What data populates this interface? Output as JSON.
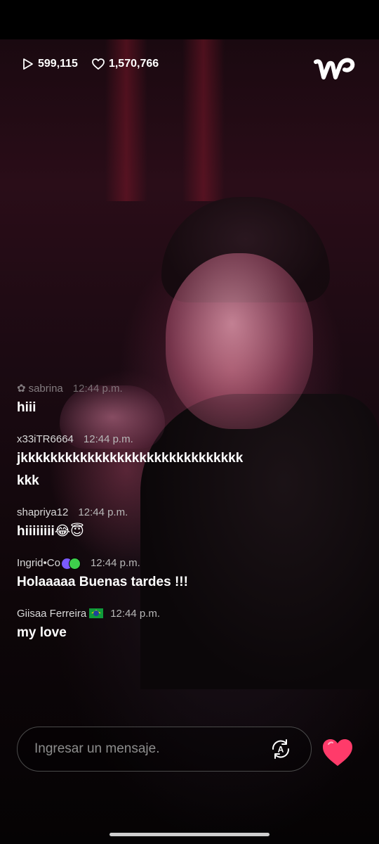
{
  "stats": {
    "plays_icon": "play-icon",
    "plays": "599,115",
    "likes_icon": "heart-outline-icon",
    "likes": "1,570,766"
  },
  "logo": {
    "icon": "weverse-logo"
  },
  "chat": {
    "messages": [
      {
        "user": "sabrina",
        "time": "12:44 p.m.",
        "text": "hiii"
      },
      {
        "user": "x33iTR6664",
        "time": "12:44 p.m.",
        "text": "jkkkkkkkkkkkkkkkkkkkkkkkkkkkkkkkkk"
      },
      {
        "user": "shapriya12",
        "time": "12:44 p.m.",
        "text": "hiiiiiiii😂😇"
      },
      {
        "user": "Ingrid•Co",
        "time": "12:44 p.m.",
        "text": "Holaaaaa Buenas tardes !!!"
      },
      {
        "user": "Giisaa Ferreira",
        "time": "12:44 p.m.",
        "text": "my love"
      }
    ]
  },
  "input": {
    "placeholder": "Ingresar un mensaje.",
    "translate_icon": "translate-icon"
  },
  "heart_button": {
    "icon": "heart-icon",
    "color": "#ff3b6a"
  },
  "colors": {
    "background": "#000000",
    "text": "#ffffff",
    "input_border": "#4a4a4a"
  }
}
